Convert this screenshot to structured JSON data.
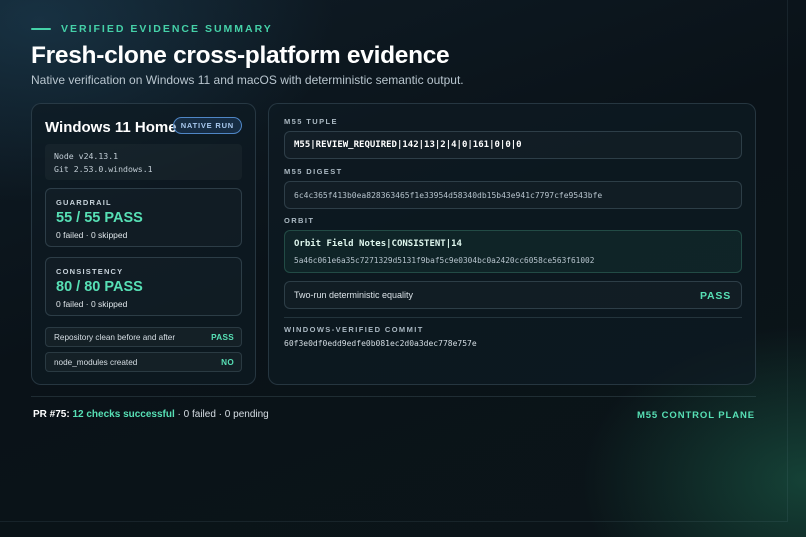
{
  "header": {
    "eyebrow": "VERIFIED EVIDENCE SUMMARY",
    "title": "Fresh-clone cross-platform evidence",
    "subtitle": "Native verification on Windows 11 and macOS with deterministic semantic output."
  },
  "platform_card": {
    "name": "Windows 11 Home",
    "badge": "NATIVE RUN",
    "node": "Node v24.13.1",
    "git": "Git 2.53.0.windows.1",
    "guardrail": {
      "label": "GUARDRAIL",
      "value": "55 / 55 PASS",
      "sub": "0 failed · 0 skipped"
    },
    "consistency": {
      "label": "CONSISTENCY",
      "value": "80 / 80 PASS",
      "sub": "0 failed · 0 skipped"
    },
    "checks": [
      {
        "label": "Repository clean before and after",
        "value": "PASS"
      },
      {
        "label": "node_modules created",
        "value": "NO"
      }
    ]
  },
  "details_card": {
    "tuple_label": "M55 TUPLE",
    "tuple_value": "M55|REVIEW_REQUIRED|142|13|2|4|0|161|0|0|0",
    "digest_label": "M55 DIGEST",
    "digest_value": "6c4c365f413b0ea828363465f1e33954d58340db15b43e941c7797cfe9543bfe",
    "orbit_label": "ORBIT",
    "orbit_title": "Orbit Field Notes|CONSISTENT|14",
    "orbit_hash": "5a46c061e6a35c7271329d5131f9baf5c9e0304bc0a2420cc6058ce563f61002",
    "equality_label": "Two-run deterministic equality",
    "equality_value": "PASS",
    "commit_label": "WINDOWS-VERIFIED COMMIT",
    "commit_value": "60f3e0df0edd9edfe0b081ec2d0a3dec778e757e"
  },
  "footer": {
    "pr_number": "PR #75:",
    "pr_success": "12 checks successful",
    "pr_rest": "· 0 failed · 0 pending",
    "plane": "M55 CONTROL PLANE"
  }
}
